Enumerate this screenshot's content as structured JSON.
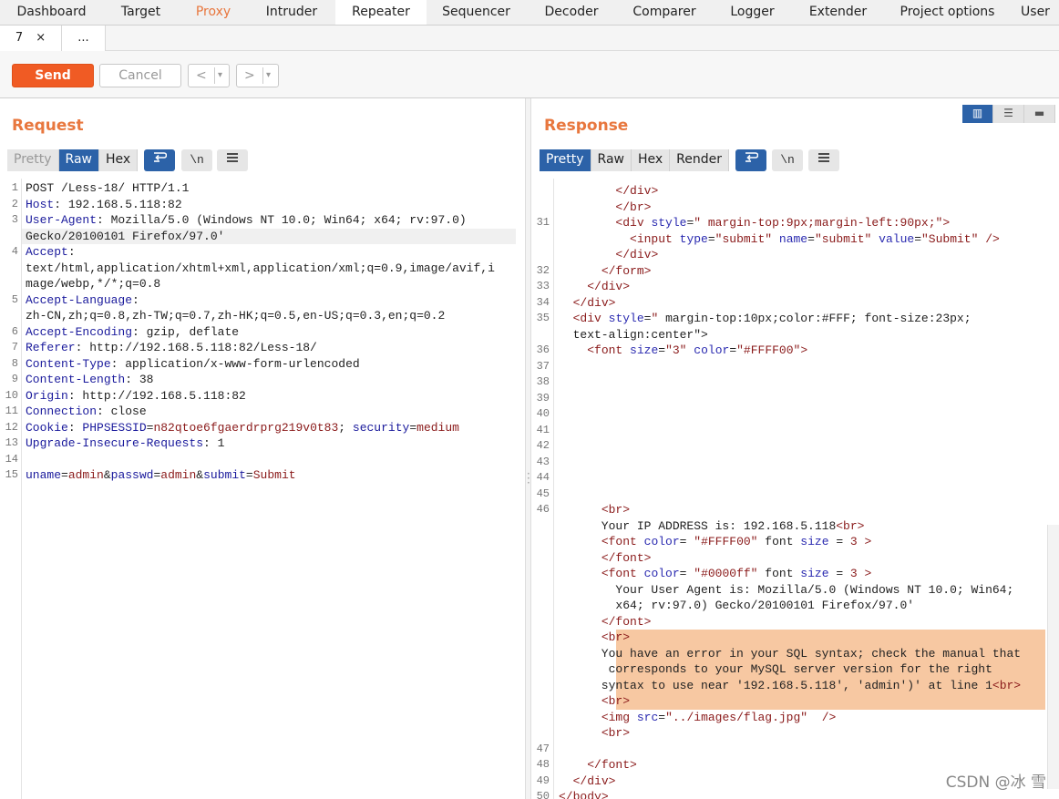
{
  "nav": {
    "tabs": [
      "Dashboard",
      "Target",
      "Proxy",
      "Intruder",
      "Repeater",
      "Sequencer",
      "Decoder",
      "Comparer",
      "Logger",
      "Extender",
      "Project options",
      "User"
    ],
    "active": "Repeater"
  },
  "subtabs": {
    "current": "7",
    "close": "×",
    "more": "..."
  },
  "toolbar": {
    "send_label": "Send",
    "cancel_label": "Cancel",
    "prev": "<",
    "next": ">",
    "dropdown": "▾"
  },
  "request": {
    "title": "Request",
    "view_tabs": [
      "Pretty",
      "Raw",
      "Hex"
    ],
    "active_view": "Raw",
    "lines": [
      {
        "n": "1",
        "t": "POST /Less-18/ HTTP/1.1"
      },
      {
        "n": "2",
        "t": "Host: 192.168.5.118:82"
      },
      {
        "n": "3",
        "t": "User-Agent: Mozilla/5.0 (Windows NT 10.0; Win64; x64; rv:97.0)"
      },
      {
        "n": "",
        "t": "Gecko/20100101 Firefox/97.0'"
      },
      {
        "n": "4",
        "t": "Accept:"
      },
      {
        "n": "",
        "t": "text/html,application/xhtml+xml,application/xml;q=0.9,image/avif,i"
      },
      {
        "n": "",
        "t": "mage/webp,*/*;q=0.8"
      },
      {
        "n": "5",
        "t": "Accept-Language:"
      },
      {
        "n": "",
        "t": "zh-CN,zh;q=0.8,zh-TW;q=0.7,zh-HK;q=0.5,en-US;q=0.3,en;q=0.2"
      },
      {
        "n": "6",
        "t": "Accept-Encoding: gzip, deflate"
      },
      {
        "n": "7",
        "t": "Referer: http://192.168.5.118:82/Less-18/"
      },
      {
        "n": "8",
        "t": "Content-Type: application/x-www-form-urlencoded"
      },
      {
        "n": "9",
        "t": "Content-Length: 38"
      },
      {
        "n": "10",
        "t": "Origin: http://192.168.5.118:82"
      },
      {
        "n": "11",
        "t": "Connection: close"
      },
      {
        "n": "12",
        "t": "Cookie: PHPSESSID=n82qtoe6fgaerdrprg219v0t83; security=medium"
      },
      {
        "n": "13",
        "t": "Upgrade-Insecure-Requests: 1"
      },
      {
        "n": "14",
        "t": ""
      },
      {
        "n": "15",
        "t": "uname=admin&passwd=admin&submit=Submit"
      }
    ]
  },
  "response": {
    "title": "Response",
    "view_tabs": [
      "Pretty",
      "Raw",
      "Hex",
      "Render"
    ],
    "active_view": "Pretty",
    "lines": [
      {
        "n": "",
        "t": "        </div>"
      },
      {
        "n": "",
        "t": "        </br>"
      },
      {
        "n": "31",
        "t": "        <div style=\" margin-top:9px;margin-left:90px;\">"
      },
      {
        "n": "",
        "t": "          <input type=\"submit\" name=\"submit\" value=\"Submit\" />"
      },
      {
        "n": "",
        "t": "        </div>"
      },
      {
        "n": "32",
        "t": "      </form>"
      },
      {
        "n": "33",
        "t": "    </div>"
      },
      {
        "n": "34",
        "t": "  </div>"
      },
      {
        "n": "35",
        "t": "  <div style=\" margin-top:10px;color:#FFF; font-size:23px;"
      },
      {
        "n": "",
        "t": "  text-align:center\">"
      },
      {
        "n": "36",
        "t": "    <font size=\"3\" color=\"#FFFF00\">"
      },
      {
        "n": "37",
        "t": ""
      },
      {
        "n": "38",
        "t": ""
      },
      {
        "n": "39",
        "t": ""
      },
      {
        "n": "40",
        "t": ""
      },
      {
        "n": "41",
        "t": ""
      },
      {
        "n": "42",
        "t": ""
      },
      {
        "n": "43",
        "t": ""
      },
      {
        "n": "44",
        "t": ""
      },
      {
        "n": "45",
        "t": ""
      },
      {
        "n": "46",
        "t": "      <br>"
      },
      {
        "n": "",
        "t": "      Your IP ADDRESS is: 192.168.5.118<br>"
      },
      {
        "n": "",
        "t": "      <font color= \"#FFFF00\" font size = 3 >"
      },
      {
        "n": "",
        "t": "      </font>"
      },
      {
        "n": "",
        "t": "      <font color= \"#0000ff\" font size = 3 >"
      },
      {
        "n": "",
        "t": "        Your User Agent is: Mozilla/5.0 (Windows NT 10.0; Win64;"
      },
      {
        "n": "",
        "t": "        x64; rv:97.0) Gecko/20100101 Firefox/97.0'"
      },
      {
        "n": "",
        "t": "      </font>"
      },
      {
        "n": "",
        "t": "      <br>",
        "hl": true
      },
      {
        "n": "",
        "t": "      You have an error in your SQL syntax; check the manual that",
        "hl": true
      },
      {
        "n": "",
        "t": "       corresponds to your MySQL server version for the right ",
        "hl": true
      },
      {
        "n": "",
        "t": "      syntax to use near '192.168.5.118', 'admin')' at line 1<br>",
        "hl": true
      },
      {
        "n": "",
        "t": "      <br>",
        "hl": true
      },
      {
        "n": "",
        "t": "      <img src=\"../images/flag.jpg\"  />"
      },
      {
        "n": "",
        "t": "      <br>"
      },
      {
        "n": "47",
        "t": ""
      },
      {
        "n": "48",
        "t": "    </font>"
      },
      {
        "n": "49",
        "t": "  </div>"
      },
      {
        "n": "50",
        "t": "</body>"
      }
    ]
  },
  "watermark": "CSDN @冰 雪"
}
